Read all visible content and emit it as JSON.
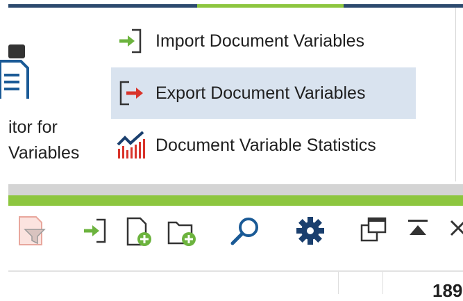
{
  "ribbon": {
    "big_button": {
      "line1": "itor for",
      "line2": "Variables",
      "icon": "document-editor-icon"
    },
    "menu": [
      {
        "label": "Import Document Variables",
        "icon": "import-icon",
        "selected": false
      },
      {
        "label": "Export Document Variables",
        "icon": "export-icon",
        "selected": true
      },
      {
        "label": "Document Variable Statistics",
        "icon": "statistics-chart-icon",
        "selected": false
      }
    ]
  },
  "toolbar": {
    "icons": [
      "filter-icon",
      "import-icon",
      "new-document-icon",
      "new-folder-icon",
      "search-icon",
      "settings-gear-icon",
      "window-icon",
      "move-to-top-icon",
      "close-icon"
    ]
  },
  "table": {
    "header_value": "189"
  },
  "colors": {
    "accent_green": "#8dc63f",
    "accent_navy": "#2c4a6e",
    "selected_bg": "#d9e3ef",
    "export_red": "#d9342b",
    "icon_blue": "#1a5a96"
  }
}
